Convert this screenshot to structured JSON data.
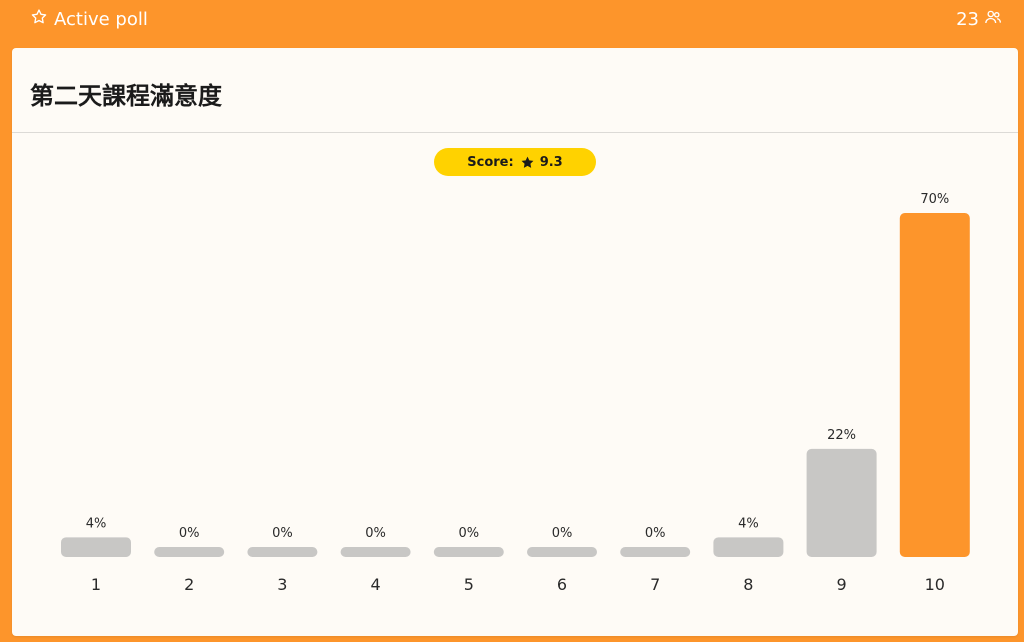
{
  "header": {
    "title": "Active poll",
    "participant_count": "23"
  },
  "poll": {
    "question": "第二天課程滿意度",
    "score_label": "Score:",
    "score_value": "9.3"
  },
  "icons": {
    "title_icon": "star-outline-icon",
    "participants_icon": "users-icon",
    "score_icon": "star-filled-icon"
  },
  "colors": {
    "brand": "#fd952b",
    "highlight_bar": "#fd952b",
    "bar": "#c8c7c5",
    "score_pill": "#ffd200",
    "card": "#fefbf6"
  },
  "chart_data": {
    "type": "bar",
    "categories": [
      "1",
      "2",
      "3",
      "4",
      "5",
      "6",
      "7",
      "8",
      "9",
      "10"
    ],
    "values": [
      4,
      0,
      0,
      0,
      0,
      0,
      0,
      4,
      22,
      70
    ],
    "value_labels": [
      "4%",
      "0%",
      "0%",
      "0%",
      "0%",
      "0%",
      "0%",
      "4%",
      "22%",
      "70%"
    ],
    "unit": "%",
    "ylim": [
      0,
      70
    ],
    "highlight_category": "10",
    "grid": false
  }
}
